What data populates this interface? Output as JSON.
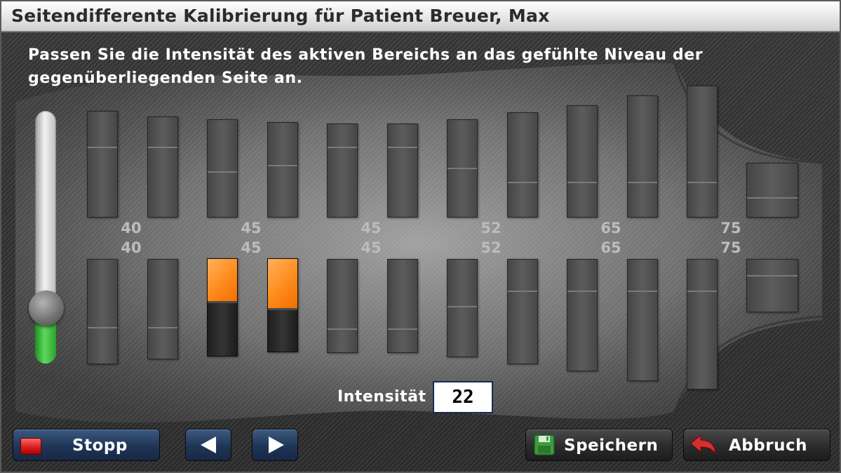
{
  "window": {
    "title": "Seitendifferente Kalibrierung für Patient Breuer, Max"
  },
  "instruction": "Passen Sie die Intensität des aktiven Bereichs an das gefühlte Niveau der gegenüberliegenden Seite an.",
  "intensity_slider": {
    "value_fraction": 0.22,
    "fill_color": "#3cc43c"
  },
  "value_columns": [
    {
      "top": "40",
      "bottom": "40"
    },
    {
      "top": "45",
      "bottom": "45"
    },
    {
      "top": "45",
      "bottom": "45"
    },
    {
      "top": "52",
      "bottom": "52"
    },
    {
      "top": "65",
      "bottom": "65"
    },
    {
      "top": "75",
      "bottom": "75"
    }
  ],
  "active_indicator_color": "#ff8a1c",
  "intensity": {
    "label": "Intensität",
    "value": "22"
  },
  "buttons": {
    "stop": {
      "label": "Stopp",
      "icon": "stop-square-icon"
    },
    "prev": {
      "icon": "arrow-left-icon"
    },
    "next": {
      "icon": "arrow-right-icon"
    },
    "save": {
      "label": "Speichern",
      "icon": "floppy-disk-icon"
    },
    "cancel": {
      "label": "Abbruch",
      "icon": "undo-arrow-icon"
    }
  }
}
